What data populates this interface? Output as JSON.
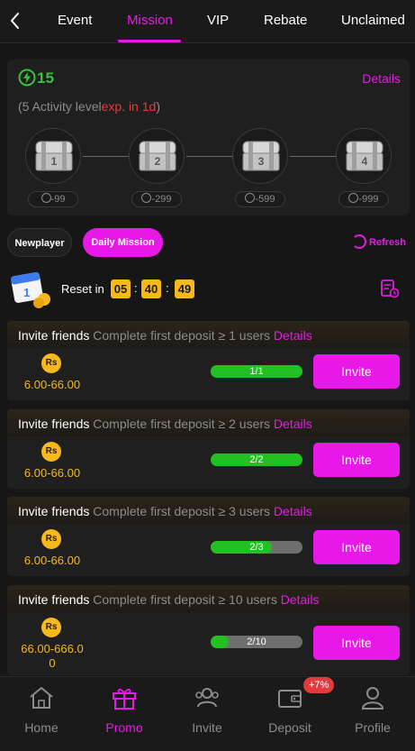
{
  "tabs": [
    "Event",
    "Mission",
    "VIP",
    "Rebate",
    "Unclaimed"
  ],
  "active_tab": "Mission",
  "level": {
    "value": "15",
    "details_label": "Details",
    "activity_prefix": "(5  Activity level",
    "activity_exp": "exp. in 1d",
    "activity_suffix": ")"
  },
  "chests": [
    {
      "num": "1",
      "cost": "-99"
    },
    {
      "num": "2",
      "cost": "-299"
    },
    {
      "num": "3",
      "cost": "-599"
    },
    {
      "num": "4",
      "cost": "-999"
    }
  ],
  "mode": {
    "newplayer": "Newplayer",
    "daily": "Daily Mission",
    "refresh": "Refresh"
  },
  "reset": {
    "label": "Reset in",
    "hh": "05",
    "mm": "40",
    "ss": "49",
    "sep": ":"
  },
  "missions": [
    {
      "title": "Invite friends",
      "desc": "Complete first deposit ≥ 1 users",
      "details": "Details",
      "currency": "Rs",
      "reward": "6.00-66.00",
      "progress": "1/1",
      "fraction": 1.0,
      "button": "Invite"
    },
    {
      "title": "Invite friends",
      "desc": "Complete first deposit ≥ 2 users",
      "details": "Details",
      "currency": "Rs",
      "reward": "6.00-66.00",
      "progress": "2/2",
      "fraction": 1.0,
      "button": "Invite"
    },
    {
      "title": "Invite friends",
      "desc": "Complete first deposit ≥ 3 users",
      "details": "Details",
      "currency": "Rs",
      "reward": "6.00-66.00",
      "progress": "2/3",
      "fraction": 0.667,
      "button": "Invite"
    },
    {
      "title": "Invite friends",
      "desc": "Complete first deposit ≥ 10 users",
      "details": "Details",
      "currency": "Rs",
      "reward": "66.00-666.0\n0",
      "progress": "2/10",
      "fraction": 0.2,
      "button": "Invite"
    }
  ],
  "nav": [
    {
      "label": "Home",
      "icon": "home-icon"
    },
    {
      "label": "Promo",
      "icon": "gift-icon"
    },
    {
      "label": "Invite",
      "icon": "invite-icon"
    },
    {
      "label": "Deposit",
      "icon": "wallet-icon"
    },
    {
      "label": "Profile",
      "icon": "profile-icon"
    }
  ],
  "active_nav": "Promo",
  "deposit_badge": "+7%",
  "colors": {
    "accent": "#e819e8",
    "green": "#23c023",
    "gold": "#f6b81b"
  }
}
